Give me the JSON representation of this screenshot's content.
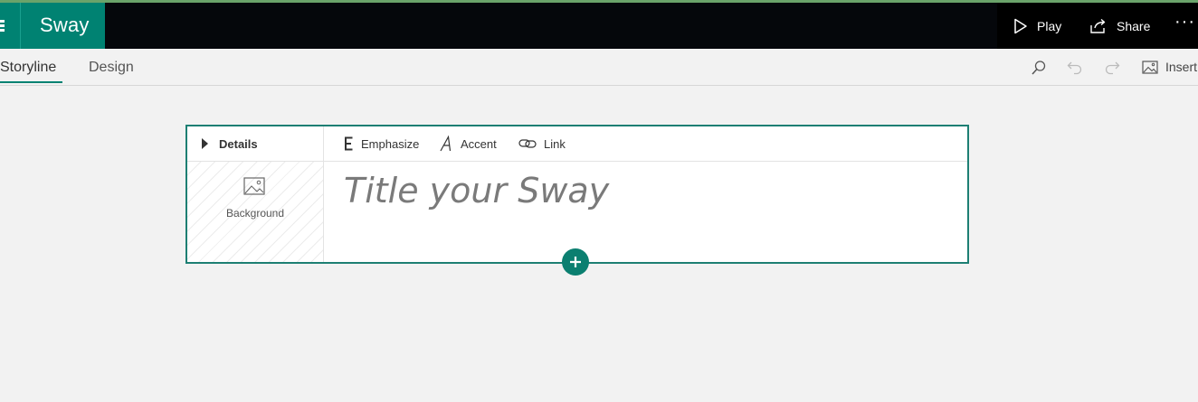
{
  "app": {
    "name": "Sway"
  },
  "header": {
    "play_label": "Play",
    "share_label": "Share",
    "more_label": "···"
  },
  "tabs": [
    {
      "label": "Storyline",
      "active": true
    },
    {
      "label": "Design",
      "active": false
    }
  ],
  "toolbar": {
    "insert_label": "Insert"
  },
  "card": {
    "details_label": "Details",
    "background_label": "Background",
    "format": {
      "emphasize_label": "Emphasize",
      "accent_label": "Accent",
      "link_label": "Link"
    },
    "title_placeholder": "Title your Sway",
    "title_value": ""
  },
  "colors": {
    "brand": "#008272",
    "header_bg": "#05070b",
    "canvas_bg": "#f2f2f2",
    "accent_line": "#6aa36a"
  }
}
